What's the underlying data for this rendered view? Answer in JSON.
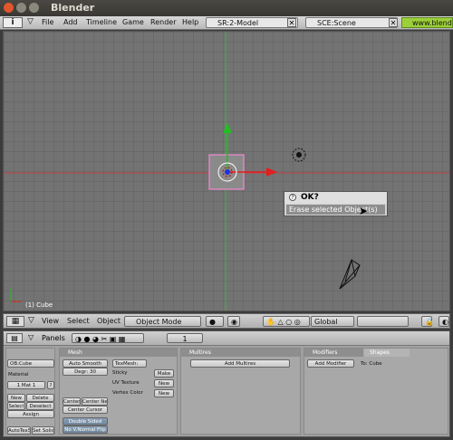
{
  "window": {
    "title": "Blender"
  },
  "menubar": {
    "items": [
      "File",
      "Add",
      "Timeline",
      "Game",
      "Render",
      "Help"
    ],
    "screen_field": "SR:2-Model",
    "scene_field": "SCE:Scene",
    "website": "www.blend"
  },
  "viewport": {
    "object_label": "(1) Cube"
  },
  "dialog": {
    "title": "OK?",
    "option": "Erase selected Object(s)"
  },
  "view_header": {
    "menus": [
      "View",
      "Select",
      "Object"
    ],
    "mode": "Object Mode",
    "orientation": "Global"
  },
  "buttons": {
    "header": {
      "label": "Panels",
      "frame": "1"
    },
    "link_panel": {
      "ob_field": "OB:Cube",
      "material_label": "Material",
      "mat_field": "1 Mat 1",
      "mat_query": "?",
      "new": "New",
      "delete": "Delete",
      "select": "Select",
      "deselect": "Deselect",
      "assign": "Assign",
      "autotex": "AutoTexSpace",
      "set_solid": "Set Solid"
    },
    "mesh_panel": {
      "title": "Mesh",
      "auto_smooth": "Auto Smooth",
      "degr": "Degr: 30",
      "tex_mesh": "TexMesh:",
      "sticky": "Sticky",
      "sticky_btn": "Make",
      "uv_texture": "UV Texture",
      "uv_btn": "New",
      "vertex_color": "Vertex Color",
      "vc_btn": "New",
      "center": "Center",
      "center_new": "Center New",
      "center_cursor": "Center Cursor",
      "double_sided": "Double Sided",
      "no_v_normal_flip": "No V.Normal Flip"
    },
    "multires_panel": {
      "title": "Multires",
      "add": "Add Multires"
    },
    "modifiers_panel": {
      "tab_modifiers": "Modifiers",
      "tab_shapes": "Shapes",
      "add": "Add Modifier",
      "to": "To: Cube"
    }
  },
  "colors": {
    "x_axis": "#e02020",
    "y_axis": "#20b020",
    "selection": "#f08ad0",
    "viewport_bg": "#737373"
  }
}
